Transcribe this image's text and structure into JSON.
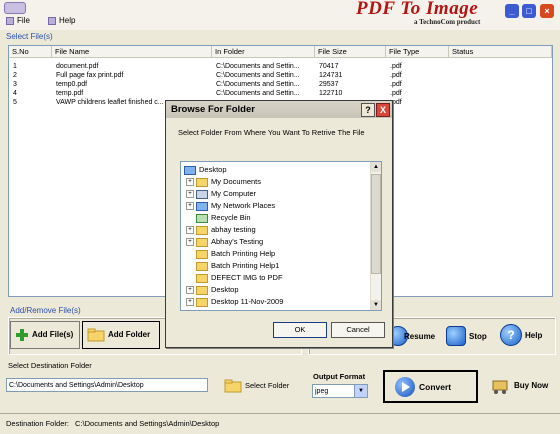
{
  "menu": {
    "file": "File",
    "help": "Help"
  },
  "brand": {
    "title": "PDF To Image",
    "subtitle": "a TechnoCom product"
  },
  "sections": {
    "select_files": "Select File(s)",
    "add_remove": "Add/Remove File(s)",
    "select_destination": "Select Destination  Folder"
  },
  "table": {
    "columns": [
      "S.No",
      "File Name",
      "In Folder",
      "File Size",
      "File Type",
      "Status"
    ],
    "rows": [
      [
        "1",
        "document.pdf",
        "C:\\Documents and Settin...",
        "70417",
        ".pdf",
        ""
      ],
      [
        "2",
        "Full page fax print.pdf",
        "C:\\Documents and Settin...",
        "124731",
        ".pdf",
        ""
      ],
      [
        "3",
        "temp0.pdf",
        "C:\\Documents and Settin...",
        "29537",
        ".pdf",
        ""
      ],
      [
        "4",
        "temp.pdf",
        "C:\\Documents and Settin...",
        "122710",
        ".pdf",
        ""
      ],
      [
        "5",
        "VAWP childrens leaflet finished c...",
        "",
        "",
        ".pdf",
        ""
      ]
    ]
  },
  "buttons": {
    "add_files": "Add File(s)",
    "add_folder": "Add Folder",
    "resume": "Resume",
    "stop": "Stop",
    "help": "Help",
    "select_folder": "Select Folder",
    "convert": "Convert",
    "buy_now": "Buy Now"
  },
  "destination": {
    "path": "C:\\Documents and Settings\\Admin\\Desktop"
  },
  "output_format": {
    "label": "Output Format",
    "selected": "jpeg"
  },
  "status_bar": {
    "label": "Destination Folder:",
    "path": "C:\\Documents and Settings\\Admin\\Desktop"
  },
  "dialog": {
    "title": "Browse For Folder",
    "prompt": "Select Folder From Where You Want To Retrive The File",
    "tree": [
      {
        "label": "Desktop",
        "icon": "desktop-icon",
        "expander": ""
      },
      {
        "label": "My Documents",
        "icon": "folder-icon",
        "expander": "+"
      },
      {
        "label": "My Computer",
        "icon": "computer-icon",
        "expander": "+"
      },
      {
        "label": "My Network Places",
        "icon": "network-icon",
        "expander": "+"
      },
      {
        "label": "Recycle Bin",
        "icon": "recycle-bin-icon",
        "expander": ""
      },
      {
        "label": "abhay testing",
        "icon": "folder-icon",
        "expander": "+"
      },
      {
        "label": "Abhay's Testing",
        "icon": "folder-icon",
        "expander": "+"
      },
      {
        "label": "Batch Printing Help",
        "icon": "folder-icon",
        "expander": ""
      },
      {
        "label": "Batch Printing Help1",
        "icon": "folder-icon",
        "expander": ""
      },
      {
        "label": "DEFECT IMG to PDF",
        "icon": "folder-icon",
        "expander": ""
      },
      {
        "label": "Desktop",
        "icon": "folder-icon",
        "expander": "+"
      },
      {
        "label": "Desktop 11-Nov-2009",
        "icon": "folder-icon",
        "expander": "+"
      }
    ],
    "ok": "OK",
    "cancel": "Cancel",
    "help_btn": "?",
    "close_btn": "X"
  },
  "colors": {
    "accent_title": "#b41414",
    "section_label": "#2d4fb0"
  }
}
